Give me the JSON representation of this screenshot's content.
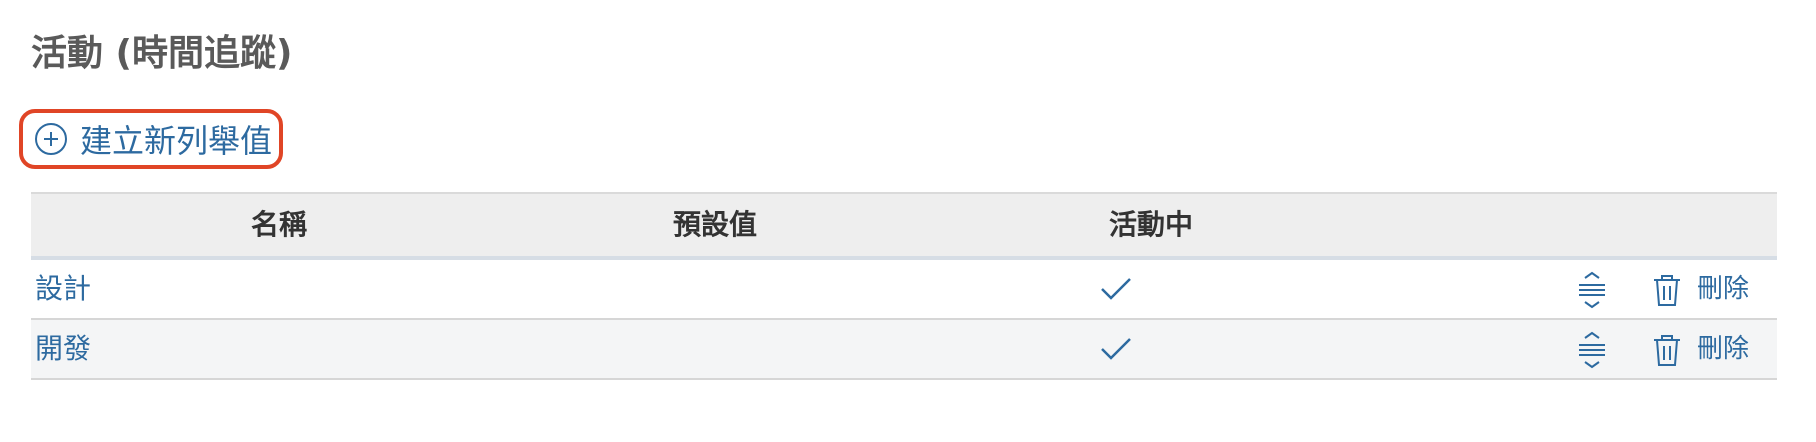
{
  "page": {
    "title": "活動 (時間追蹤)"
  },
  "actions": {
    "create_label": "建立新列舉值",
    "create_icon": "plus-circle-icon"
  },
  "table": {
    "columns": [
      "名稱",
      "預設值",
      "活動中"
    ],
    "rows": [
      {
        "name": "設計",
        "default": false,
        "active": true,
        "delete_label": "刪除"
      },
      {
        "name": "開發",
        "default": false,
        "active": true,
        "delete_label": "刪除"
      }
    ]
  },
  "colors": {
    "link": "#2d6aa0",
    "highlight_border": "#e04526",
    "header_bg": "#eeeeee"
  }
}
